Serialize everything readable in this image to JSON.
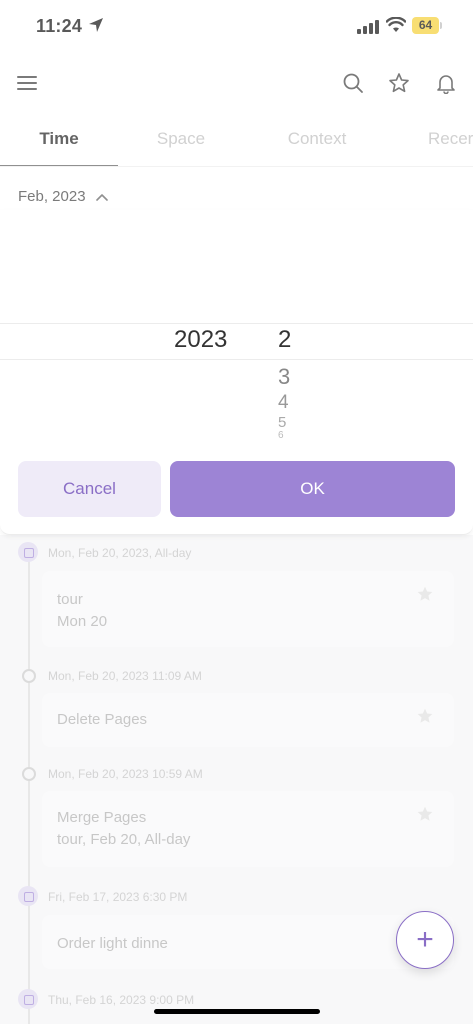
{
  "status_bar": {
    "time": "11:24",
    "battery": "64"
  },
  "header": {
    "menu_icon": "hamburger-menu-icon",
    "search_icon": "search-icon",
    "favorites_icon": "star-icon",
    "notifications_icon": "bell-icon"
  },
  "tabs": [
    {
      "label": "Time",
      "active": true
    },
    {
      "label": "Space",
      "active": false
    },
    {
      "label": "Context",
      "active": false
    },
    {
      "label": "Recer",
      "active": false
    }
  ],
  "month_selector": {
    "label": "Feb, 2023"
  },
  "picker": {
    "year": "2023",
    "selected_month": "2",
    "following_months": [
      "3",
      "4",
      "5",
      "6"
    ],
    "cancel_label": "Cancel",
    "ok_label": "OK"
  },
  "timeline": [
    {
      "date": "Mon, Feb 20, 2023, All-day",
      "title": "tour",
      "subtitle": "Mon 20",
      "dot": "calendar"
    },
    {
      "date": "Mon, Feb 20, 2023 11:09 AM",
      "title": "Delete Pages",
      "subtitle": "",
      "dot": "circle"
    },
    {
      "date": "Mon, Feb 20, 2023 10:59 AM",
      "title": "Merge Pages",
      "subtitle": "tour, Feb 20, All-day",
      "dot": "circle"
    },
    {
      "date": "Fri, Feb 17, 2023 6:30 PM",
      "title": "Order light dinne",
      "subtitle": "",
      "dot": "calendar"
    },
    {
      "date": "Thu, Feb 16, 2023 9:00 PM",
      "title": "",
      "subtitle": "",
      "dot": "calendar"
    }
  ],
  "fab": {
    "label": "+"
  },
  "colors": {
    "accent": "#9d84d5",
    "accent_light": "#efebf8",
    "accent_text": "#8a6ec6"
  }
}
